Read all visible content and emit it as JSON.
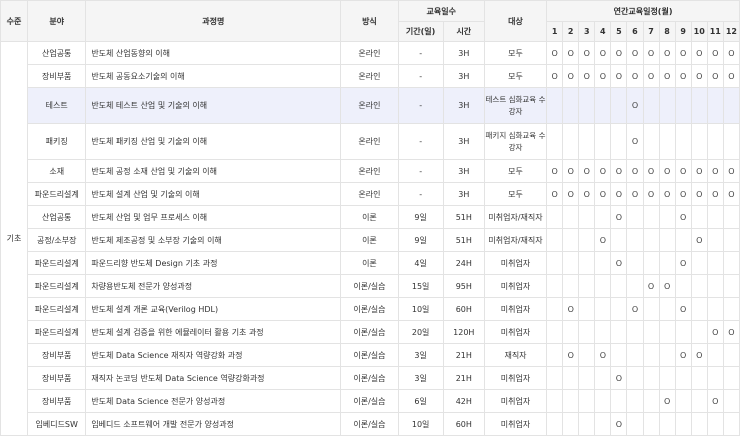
{
  "headers": {
    "level": "수준",
    "field": "분야",
    "course": "과정명",
    "method": "방식",
    "days_group": "교육일수",
    "period": "기간(일)",
    "hours": "시간",
    "target": "대상",
    "schedule": "연간교육일정(월)",
    "months": [
      "1",
      "2",
      "3",
      "4",
      "5",
      "6",
      "7",
      "8",
      "9",
      "10",
      "11",
      "12"
    ]
  },
  "level_value": "기초",
  "mark_symbol": "O",
  "highlight_row": 2,
  "rows": [
    {
      "field": "산업공통",
      "course": "반도체 산업동향의 이해",
      "method": "온라인",
      "period": "-",
      "hours": "3H",
      "target": "모두",
      "months": [
        1,
        1,
        1,
        1,
        1,
        1,
        1,
        1,
        1,
        1,
        1,
        1
      ]
    },
    {
      "field": "장비부품",
      "course": "반도체 공동요소기술의 이해",
      "method": "온라인",
      "period": "-",
      "hours": "3H",
      "target": "모두",
      "months": [
        1,
        1,
        1,
        1,
        1,
        1,
        1,
        1,
        1,
        1,
        1,
        1
      ]
    },
    {
      "field": "테스트",
      "course": "반도체 테스트 산업 및 기술의 이해",
      "method": "온라인",
      "period": "-",
      "hours": "3H",
      "target": "테스트 심화교육 수강자",
      "months": [
        0,
        0,
        0,
        0,
        0,
        1,
        0,
        0,
        0,
        0,
        0,
        0
      ]
    },
    {
      "field": "패키징",
      "course": "반도체 패키징 산업 및 기술의 이해",
      "method": "온라인",
      "period": "-",
      "hours": "3H",
      "target": "패키지 심화교육 수강자",
      "months": [
        0,
        0,
        0,
        0,
        0,
        1,
        0,
        0,
        0,
        0,
        0,
        0
      ]
    },
    {
      "field": "소재",
      "course": "반도체 공정 소재 산업 및 기술의 이해",
      "method": "온라인",
      "period": "-",
      "hours": "3H",
      "target": "모두",
      "months": [
        1,
        1,
        1,
        1,
        1,
        1,
        1,
        1,
        1,
        1,
        1,
        1
      ]
    },
    {
      "field": "파운드리설계",
      "course": "반도체 설계 산업 및 기술의 이해",
      "method": "온라인",
      "period": "-",
      "hours": "3H",
      "target": "모두",
      "months": [
        1,
        1,
        1,
        1,
        1,
        1,
        1,
        1,
        1,
        1,
        1,
        1
      ]
    },
    {
      "field": "산업공통",
      "course": "반도체 산업 및 업무 프로세스 이해",
      "method": "이론",
      "period": "9일",
      "hours": "51H",
      "target": "미취업자/재직자",
      "months": [
        0,
        0,
        0,
        0,
        1,
        0,
        0,
        0,
        1,
        0,
        0,
        0
      ]
    },
    {
      "field": "공정/소부장",
      "course": "반도체 제조공정 및 소부장 기술의 이해",
      "method": "이론",
      "period": "9일",
      "hours": "51H",
      "target": "미취업자/재직자",
      "months": [
        0,
        0,
        0,
        1,
        0,
        0,
        0,
        0,
        0,
        1,
        0,
        0
      ]
    },
    {
      "field": "파운드리설계",
      "course": "파운드리향 반도체 Design 기초 과정",
      "method": "이론",
      "period": "4일",
      "hours": "24H",
      "target": "미취업자",
      "months": [
        0,
        0,
        0,
        0,
        1,
        0,
        0,
        0,
        1,
        0,
        0,
        0
      ]
    },
    {
      "field": "파운드리설계",
      "course": "차량용반도체 전문가 양성과정",
      "method": "이론/실습",
      "period": "15일",
      "hours": "95H",
      "target": "미취업자",
      "months": [
        0,
        0,
        0,
        0,
        0,
        0,
        1,
        1,
        0,
        0,
        0,
        0
      ]
    },
    {
      "field": "파운드리설계",
      "course": "반도체 설계 개론 교육(Verilog HDL)",
      "method": "이론/실습",
      "period": "10일",
      "hours": "60H",
      "target": "미취업자",
      "months": [
        0,
        1,
        0,
        0,
        0,
        1,
        0,
        0,
        1,
        0,
        0,
        0
      ]
    },
    {
      "field": "파운드리설계",
      "course": "반도체 설계 검증을 위한 에뮬레이터 활용 기초 과정",
      "method": "이론/실습",
      "period": "20일",
      "hours": "120H",
      "target": "미취업자",
      "months": [
        0,
        0,
        0,
        0,
        0,
        0,
        0,
        0,
        0,
        0,
        1,
        1
      ]
    },
    {
      "field": "장비부품",
      "course": "반도체 Data Science 재직자 역량강화 과정",
      "method": "이론/실습",
      "period": "3일",
      "hours": "21H",
      "target": "재직자",
      "months": [
        0,
        1,
        0,
        1,
        0,
        0,
        0,
        0,
        1,
        1,
        0,
        0
      ]
    },
    {
      "field": "장비부품",
      "course": "재직자 논코딩 반도체 Data Science 역량강화과정",
      "method": "이론/실습",
      "period": "3일",
      "hours": "21H",
      "target": "미취업자",
      "months": [
        0,
        0,
        0,
        0,
        1,
        0,
        0,
        0,
        0,
        0,
        0,
        0
      ]
    },
    {
      "field": "장비부품",
      "course": "반도체 Data Science 전문가 양성과정",
      "method": "이론/실습",
      "period": "6일",
      "hours": "42H",
      "target": "미취업자",
      "months": [
        0,
        0,
        0,
        0,
        0,
        0,
        0,
        1,
        0,
        0,
        1,
        0
      ]
    },
    {
      "field": "임베디드SW",
      "course": "임베디드 소프트웨어 개발 전문가 양성과정",
      "method": "이론/실습",
      "period": "10일",
      "hours": "60H",
      "target": "미취업자",
      "months": [
        0,
        0,
        0,
        0,
        1,
        0,
        0,
        0,
        0,
        0,
        0,
        0
      ]
    }
  ]
}
